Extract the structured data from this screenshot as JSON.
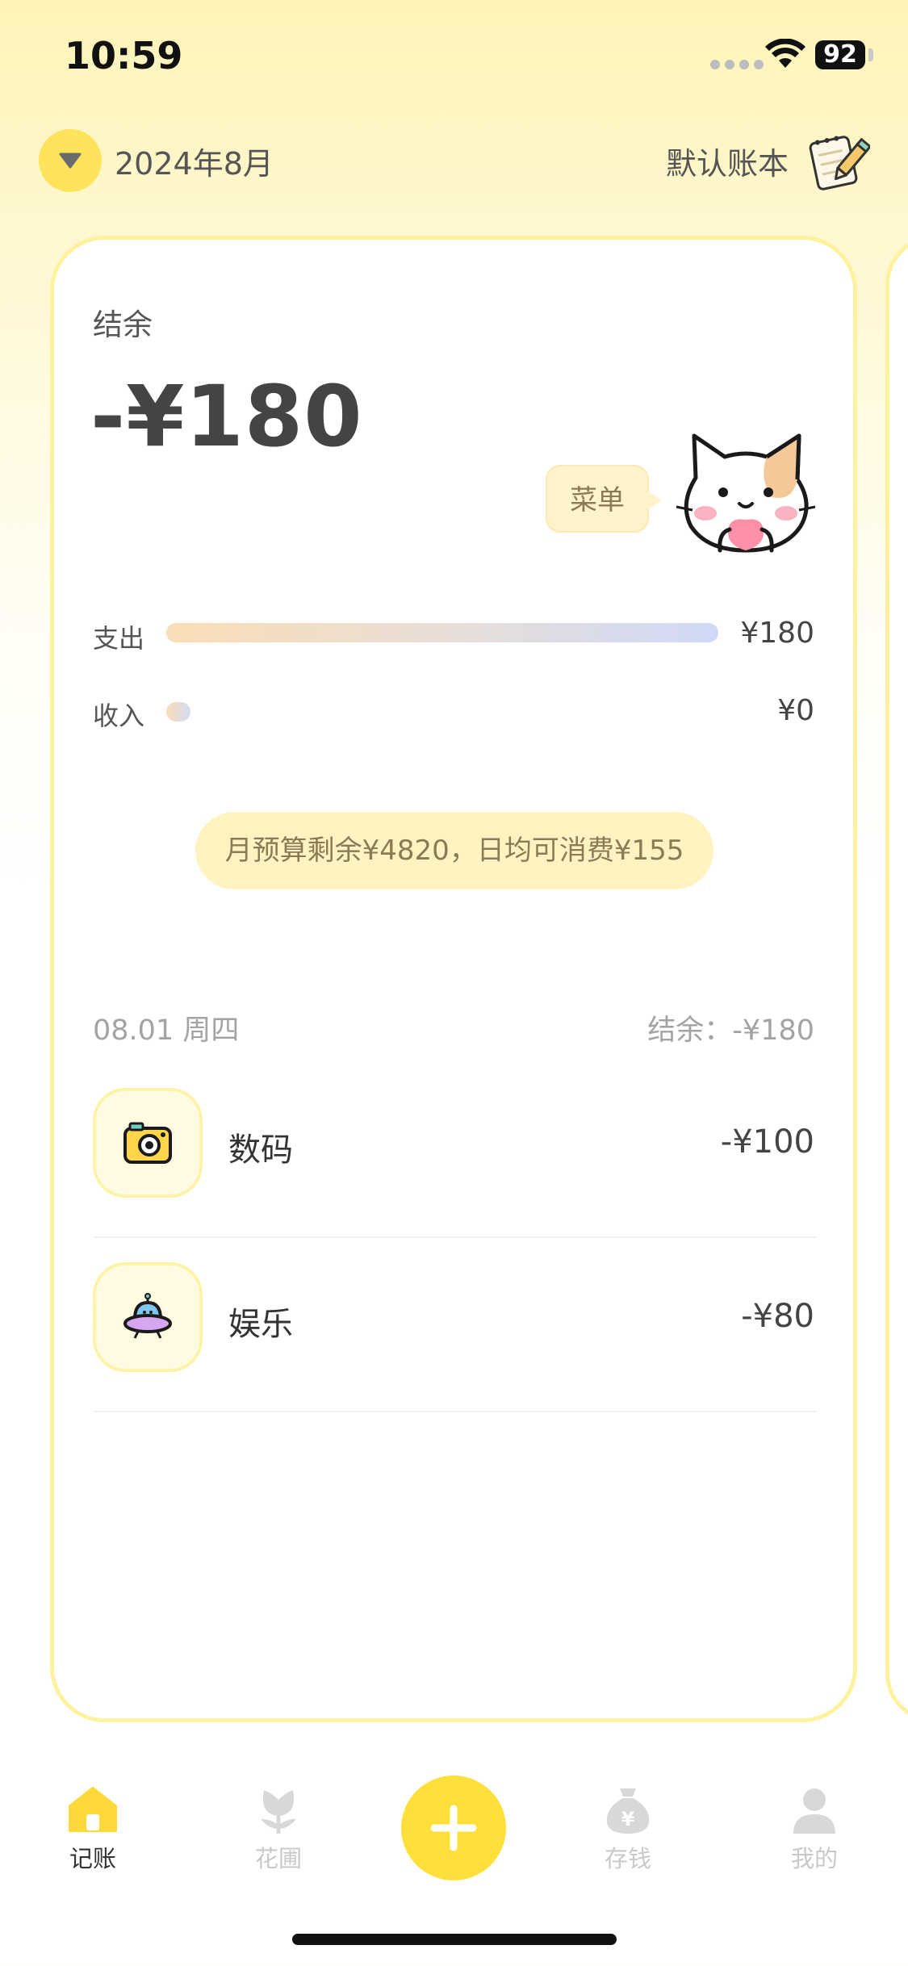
{
  "status_bar": {
    "time": "10:59",
    "battery": "92"
  },
  "header": {
    "month": "2024年8月",
    "ledger": "默认账本"
  },
  "summary": {
    "balance_label": "结余",
    "balance_amount": "-¥180",
    "menu_bubble": "菜单",
    "expense_label": "支出",
    "expense_amount": "¥180",
    "income_label": "收入",
    "income_amount": "¥0",
    "budget_text": "月预算剩余¥4820，日均可消费¥155"
  },
  "day_group": {
    "date": "08.01 周四",
    "balance": "结余：-¥180",
    "transactions": [
      {
        "category": "数码",
        "amount": "-¥100",
        "icon": "camera-icon"
      },
      {
        "category": "娱乐",
        "amount": "-¥80",
        "icon": "ufo-icon"
      }
    ]
  },
  "tabs": [
    {
      "label": "记账",
      "icon": "home-icon",
      "active": true
    },
    {
      "label": "花圃",
      "icon": "flower-icon",
      "active": false
    },
    {
      "label": "存钱",
      "icon": "money-bag-icon",
      "active": false
    },
    {
      "label": "我的",
      "icon": "person-icon",
      "active": false
    }
  ],
  "add_button": {
    "icon": "plus-icon"
  },
  "colors": {
    "accent_yellow": "#FFE03A",
    "card_border": "#FFF29E",
    "pill_bg": "#FFF3C2"
  }
}
